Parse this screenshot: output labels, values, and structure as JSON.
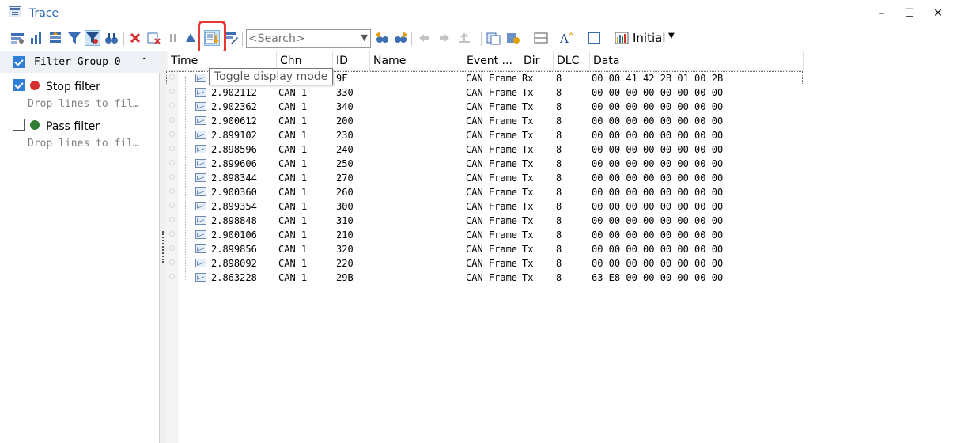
{
  "window": {
    "title": "Trace",
    "minimize": "–",
    "maximize": "☐",
    "close": "✕"
  },
  "toolbar": {
    "search_placeholder": "<Search>",
    "initial_label": "Initial",
    "tooltip": "Toggle display mode",
    "icons": [
      "filter-settings-icon",
      "column-chart-icon",
      "sort-icon",
      "funnel-icon",
      "funnel-active-icon",
      "binoculars-icon",
      "delete-icon",
      "clear-filter-icon",
      "pause-icon",
      "scroll-up-icon",
      "toggle-display-mode-icon",
      "filter-edit-icon",
      "search-prev-icon",
      "search-next-icon",
      "nav-back-icon",
      "nav-forward-icon",
      "marker-icon",
      "copy-icon",
      "copy-dropdown-icon",
      "layout-icon",
      "font-icon",
      "window-icon",
      "chart-icon"
    ]
  },
  "filter_panel": {
    "group_label": "Filter Group 0",
    "collapse_glyph": "⌃",
    "filters": [
      {
        "label": "Stop filter",
        "drop_text": "Drop lines to fil…",
        "checked": true,
        "icon": "stop-icon",
        "color": "#d32f2f"
      },
      {
        "label": "Pass filter",
        "drop_text": "Drop lines to fil…",
        "checked": false,
        "icon": "pass-icon",
        "color": "#2e7d32"
      }
    ]
  },
  "columns": [
    "Time",
    "Chn",
    "ID",
    "Name",
    "Event ...",
    "Dir",
    "DLC",
    "Data"
  ],
  "rows": [
    {
      "time": "",
      "chn": "",
      "id": "9F",
      "name": "",
      "event": "CAN Frame",
      "dir": "Rx",
      "dlc": "8",
      "data": "00 00 41 42 2B 01 00 2B"
    },
    {
      "time": "2.902112",
      "chn": "CAN 1",
      "id": "330",
      "name": "",
      "event": "CAN Frame",
      "dir": "Tx",
      "dlc": "8",
      "data": "00 00 00 00 00 00 00 00"
    },
    {
      "time": "2.902362",
      "chn": "CAN 1",
      "id": "340",
      "name": "",
      "event": "CAN Frame",
      "dir": "Tx",
      "dlc": "8",
      "data": "00 00 00 00 00 00 00 00"
    },
    {
      "time": "2.900612",
      "chn": "CAN 1",
      "id": "200",
      "name": "",
      "event": "CAN Frame",
      "dir": "Tx",
      "dlc": "8",
      "data": "00 00 00 00 00 00 00 00"
    },
    {
      "time": "2.899102",
      "chn": "CAN 1",
      "id": "230",
      "name": "",
      "event": "CAN Frame",
      "dir": "Tx",
      "dlc": "8",
      "data": "00 00 00 00 00 00 00 00"
    },
    {
      "time": "2.898596",
      "chn": "CAN 1",
      "id": "240",
      "name": "",
      "event": "CAN Frame",
      "dir": "Tx",
      "dlc": "8",
      "data": "00 00 00 00 00 00 00 00"
    },
    {
      "time": "2.899606",
      "chn": "CAN 1",
      "id": "250",
      "name": "",
      "event": "CAN Frame",
      "dir": "Tx",
      "dlc": "8",
      "data": "00 00 00 00 00 00 00 00"
    },
    {
      "time": "2.898344",
      "chn": "CAN 1",
      "id": "270",
      "name": "",
      "event": "CAN Frame",
      "dir": "Tx",
      "dlc": "8",
      "data": "00 00 00 00 00 00 00 00"
    },
    {
      "time": "2.900360",
      "chn": "CAN 1",
      "id": "260",
      "name": "",
      "event": "CAN Frame",
      "dir": "Tx",
      "dlc": "8",
      "data": "00 00 00 00 00 00 00 00"
    },
    {
      "time": "2.899354",
      "chn": "CAN 1",
      "id": "300",
      "name": "",
      "event": "CAN Frame",
      "dir": "Tx",
      "dlc": "8",
      "data": "00 00 00 00 00 00 00 00"
    },
    {
      "time": "2.898848",
      "chn": "CAN 1",
      "id": "310",
      "name": "",
      "event": "CAN Frame",
      "dir": "Tx",
      "dlc": "8",
      "data": "00 00 00 00 00 00 00 00"
    },
    {
      "time": "2.900106",
      "chn": "CAN 1",
      "id": "210",
      "name": "",
      "event": "CAN Frame",
      "dir": "Tx",
      "dlc": "8",
      "data": "00 00 00 00 00 00 00 00"
    },
    {
      "time": "2.899856",
      "chn": "CAN 1",
      "id": "320",
      "name": "",
      "event": "CAN Frame",
      "dir": "Tx",
      "dlc": "8",
      "data": "00 00 00 00 00 00 00 00"
    },
    {
      "time": "2.898092",
      "chn": "CAN 1",
      "id": "220",
      "name": "",
      "event": "CAN Frame",
      "dir": "Tx",
      "dlc": "8",
      "data": "00 00 00 00 00 00 00 00"
    },
    {
      "time": "2.863228",
      "chn": "CAN 1",
      "id": "29B",
      "name": "",
      "event": "CAN Frame",
      "dir": "Tx",
      "dlc": "8",
      "data": "63 E8 00 00 00 00 00 00"
    }
  ]
}
